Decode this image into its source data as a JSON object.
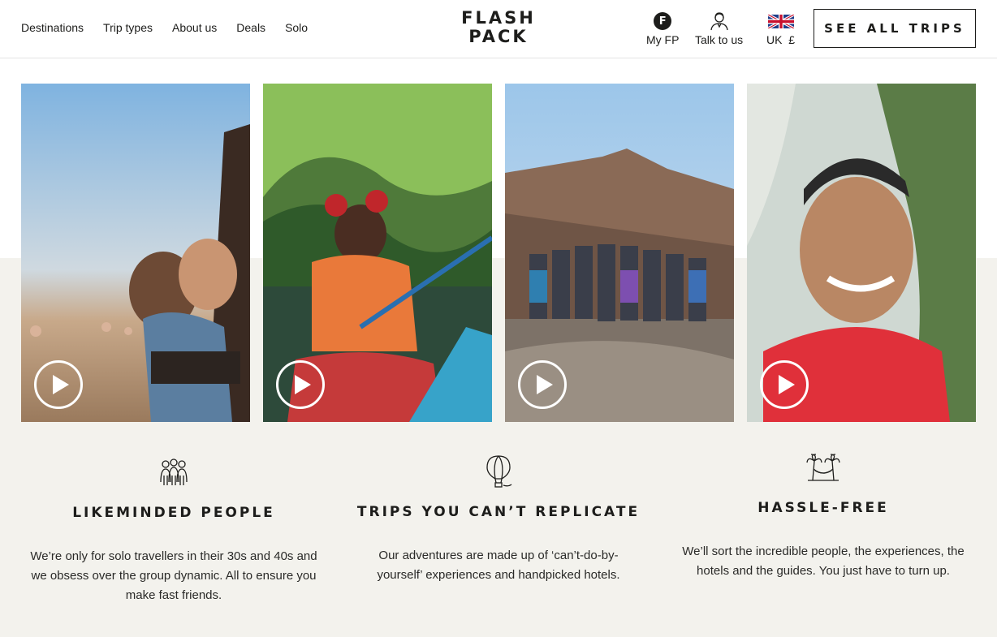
{
  "nav": {
    "items": [
      "Destinations",
      "Trip types",
      "About us",
      "Deals",
      "Solo"
    ]
  },
  "logo": {
    "line1": "FLASH",
    "line2": "PACK"
  },
  "utility": {
    "my_fp_badge": "F",
    "my_fp": "My FP",
    "talk": "Talk to us",
    "region": "UK",
    "currency": "£"
  },
  "cta": {
    "see_all_trips": "SEE ALL TRIPS"
  },
  "videos": [
    {
      "icon": "play-icon"
    },
    {
      "icon": "play-icon"
    },
    {
      "icon": "play-icon"
    },
    {
      "icon": "play-icon"
    }
  ],
  "features": [
    {
      "icon": "people-group-icon",
      "title": "LIKEMINDED PEOPLE",
      "text": "We’re only for solo travellers in their 30s and 40s and we obsess over the group dynamic. All to ensure you make fast friends."
    },
    {
      "icon": "hot-air-balloon-icon",
      "title": "TRIPS YOU CAN’T REPLICATE",
      "text": "Our adventures are made up of ‘can’t-do-by-yourself’ experiences and handpicked hotels."
    },
    {
      "icon": "palm-hammock-icon",
      "title": "HASSLE-FREE",
      "text": "We’ll sort the incredible people, the experiences, the hotels and the guides. You just have to turn up."
    }
  ],
  "colors": {
    "text": "#1d1d1b",
    "band": "#f3f2ed",
    "header_border": "#e3e3e3"
  }
}
